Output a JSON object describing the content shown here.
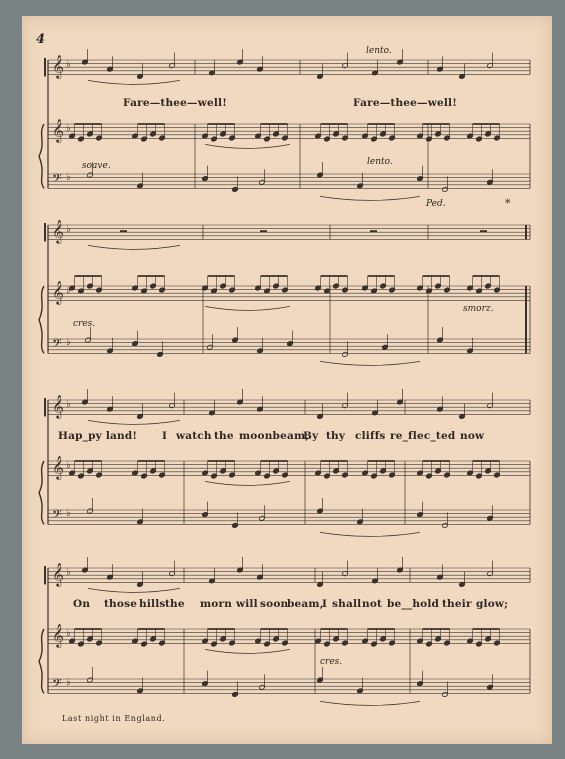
{
  "page_number": "4",
  "footer": "Last night in England.",
  "systems": [
    {
      "lyrics": [
        "Fare—thee—well!",
        "Fare—thee—well!"
      ],
      "marks": [
        "lento.",
        "soave.",
        "lento.",
        "Ped.",
        "*"
      ]
    },
    {
      "lyrics": [],
      "marks": [
        "cres.",
        "smorz."
      ]
    },
    {
      "lyrics": [
        "Hap_py land!",
        "I",
        "watch",
        "the",
        "moonbeam,",
        "By",
        "thy",
        "cliffs",
        "re_flec_ted",
        "now"
      ],
      "marks": []
    },
    {
      "lyrics": [
        "On",
        "those",
        "hills",
        "the",
        "morn",
        "will",
        "soon",
        "beam,",
        "I",
        "shall",
        "not",
        "be__hold",
        "their",
        "glow;"
      ],
      "marks": [
        "cres."
      ]
    }
  ]
}
